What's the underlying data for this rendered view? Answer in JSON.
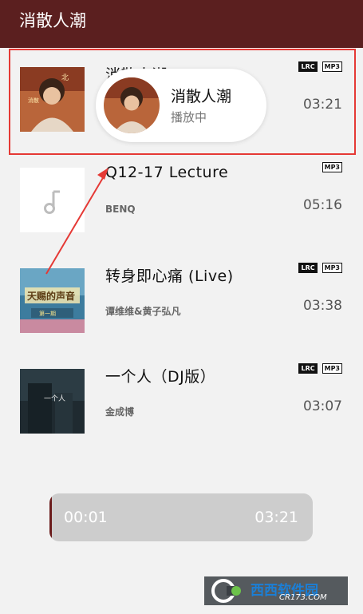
{
  "header": {
    "title": "消散人潮"
  },
  "songs": [
    {
      "title": "消散人潮",
      "artist": "",
      "duration": "03:21",
      "badges": [
        "LRC",
        "MP3"
      ],
      "cover": "album-art-portrait"
    },
    {
      "title": "Q12-17 Lecture",
      "artist": "BENQ",
      "duration": "05:16",
      "badges": [
        "MP3"
      ],
      "cover": "music-note-icon"
    },
    {
      "title": "转身即心痛 (Live)",
      "artist": "谭维维&黄子弘凡",
      "duration": "03:38",
      "badges": [
        "LRC",
        "MP3"
      ],
      "cover": "album-art-stage"
    },
    {
      "title": "一个人（DJ版）",
      "artist": "金成博",
      "duration": "03:07",
      "badges": [
        "LRC",
        "MP3"
      ],
      "cover": "album-art-night"
    }
  ],
  "popup": {
    "title": "消散人潮",
    "status": "播放中"
  },
  "player": {
    "elapsed": "00:01",
    "total": "03:21"
  },
  "watermark": {
    "brand": "西西软件园",
    "site": "CR173.COM"
  },
  "colors": {
    "header": "#5b1f1f",
    "highlight": "#e53935",
    "player_bg": "#cdcdcd"
  }
}
